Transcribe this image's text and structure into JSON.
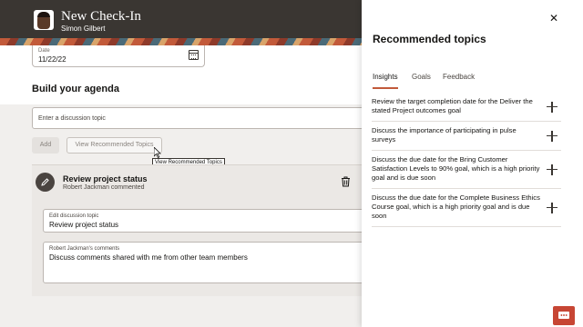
{
  "header": {
    "title": "New Check-In",
    "subtitle": "Simon Gilbert",
    "avatar_icon": "person-avatar"
  },
  "date_field": {
    "label": "Date",
    "value": "11/22/22",
    "icon": "calendar-icon"
  },
  "agenda": {
    "heading": "Build your agenda",
    "topic_placeholder": "Enter a discussion topic",
    "add_label": "Add",
    "view_recommended_label": "View Recommended Topics",
    "tooltip": "View Recommended Topics"
  },
  "agenda_item": {
    "title": "Review project status",
    "subtitle": "Robert Jackman commented",
    "edit_label": "Edit discussion topic",
    "edit_value": "Review project status",
    "comments_label": "Robert Jackman's comments",
    "comments_value": "Discuss comments shared with me from other team members"
  },
  "drawer": {
    "title": "Recommended topics",
    "close_icon": "close-icon",
    "tabs": [
      {
        "label": "Insights",
        "active": true
      },
      {
        "label": "Goals",
        "active": false
      },
      {
        "label": "Feedback",
        "active": false
      }
    ],
    "topics": [
      {
        "text": "Review the target completion date for the Deliver the stated Project outcomes goal"
      },
      {
        "text": "Discuss the importance of participating in pulse surveys"
      },
      {
        "text": "Discuss the due date for the Bring Customer Satisfaction Levels to 90% goal, which is a high priority goal and is due soon"
      },
      {
        "text": "Discuss the due date for the Complete Business Ethics Course goal, which is a high priority goal and is due soon"
      }
    ]
  },
  "colors": {
    "header_bg": "#3a3632",
    "accent": "#c25a3a",
    "chat_button": "#c74634"
  }
}
